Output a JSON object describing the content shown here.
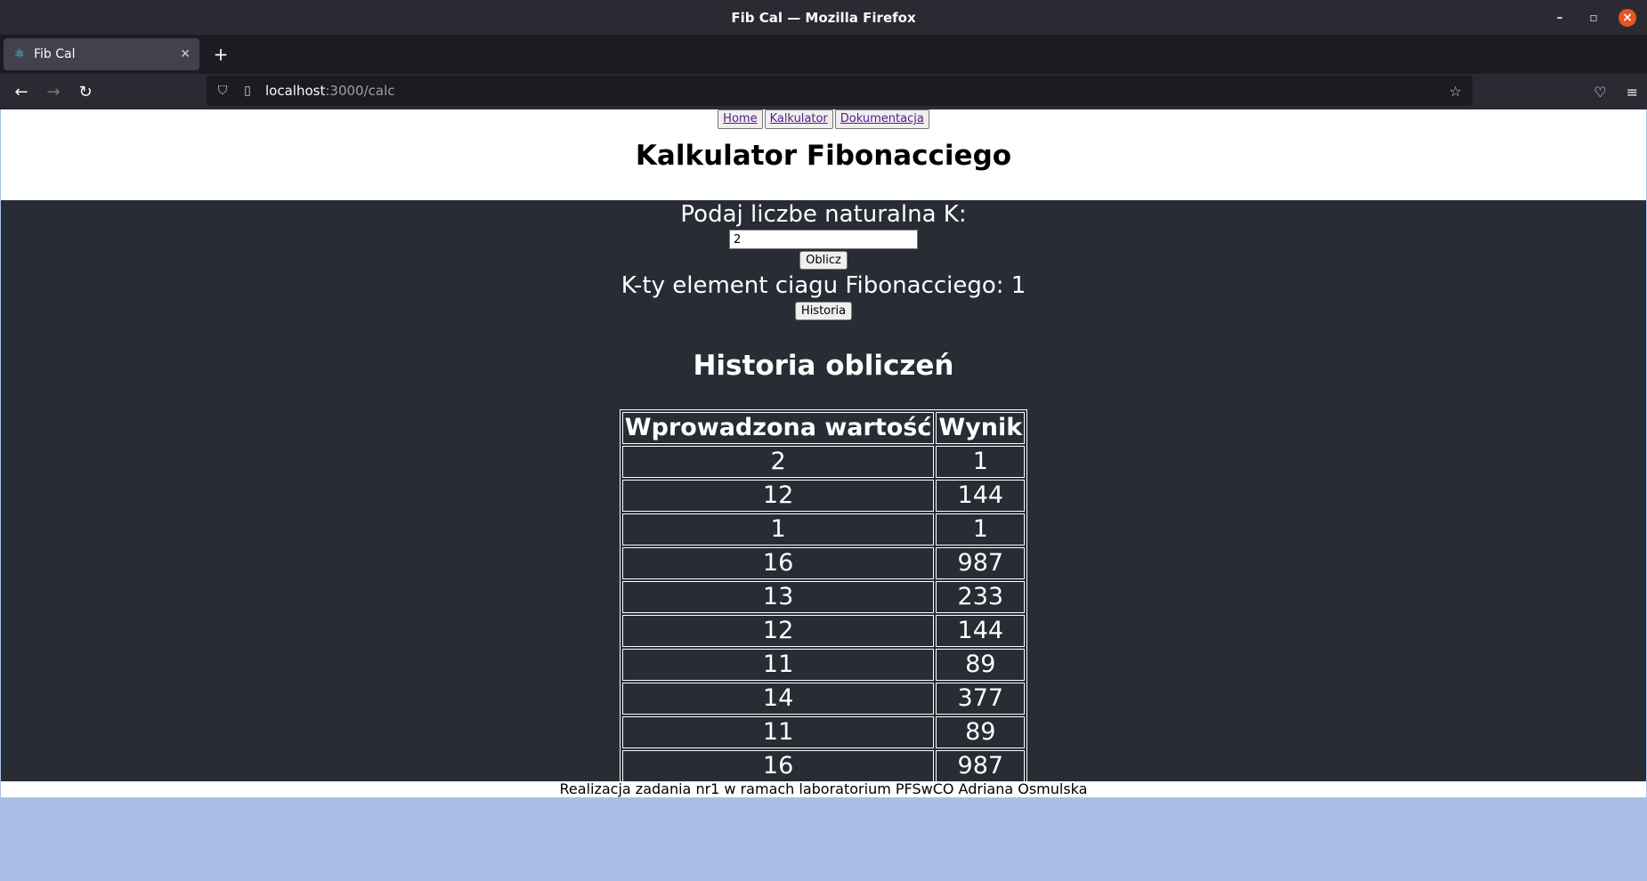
{
  "window": {
    "title": "Fib Cal — Mozilla Firefox"
  },
  "tab": {
    "title": "Fib Cal"
  },
  "url": {
    "host": "localhost",
    "path": ":3000/calc"
  },
  "menu": {
    "home": "Home",
    "calculator": "Kalkulator",
    "docs": "Dokumentacja"
  },
  "header": {
    "title": "Kalkulator Fibonacciego"
  },
  "form": {
    "prompt": "Podaj liczbe naturalna K:",
    "input_value": "2",
    "submit_label": "Oblicz",
    "result_text": "K-ty element ciagu Fibonacciego: 1",
    "history_button": "Historia"
  },
  "history": {
    "title": "Historia obliczeń",
    "columns": [
      "Wprowadzona wartość",
      "Wynik"
    ],
    "rows": [
      [
        "2",
        "1"
      ],
      [
        "12",
        "144"
      ],
      [
        "1",
        "1"
      ],
      [
        "16",
        "987"
      ],
      [
        "13",
        "233"
      ],
      [
        "12",
        "144"
      ],
      [
        "11",
        "89"
      ],
      [
        "14",
        "377"
      ],
      [
        "11",
        "89"
      ],
      [
        "16",
        "987"
      ]
    ]
  },
  "footer": {
    "text": "Realizacja zadania nr1 w ramach laboratorium PFSwCO Adriana Osmulska"
  },
  "colors": {
    "page_background": "#abbfe6",
    "main_background": "#282c34",
    "chrome_dark": "#2b2a33",
    "close_button": "#e95420"
  }
}
